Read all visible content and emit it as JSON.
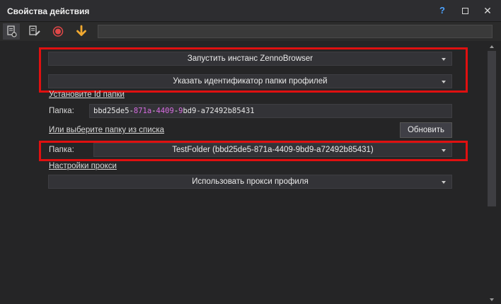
{
  "window": {
    "title": "Свойства действия",
    "help_label": "?",
    "close_label": "✕"
  },
  "toolbar": {
    "search_value": ""
  },
  "form": {
    "action_dropdown": "Запустить инстанс ZennoBrowser",
    "mode_dropdown": "Указать идентификатор папки профилей",
    "set_id_link": "Установите Id папки",
    "folder_label": "Папка:",
    "folder_id_parts": [
      "bbd25de5-",
      "871a",
      "-",
      "4409",
      "-",
      "9",
      "bd9-a72492b85431"
    ],
    "choose_link": "Или выберите папку из списка",
    "refresh_button": "Обновить",
    "folder_list_label": "Папка:",
    "folder_list_value": "TestFolder (bbd25de5-871a-4409-9bd9-a72492b85431)",
    "proxy_link": "Настройки прокси",
    "proxy_dropdown": "Использовать прокси профиля"
  },
  "colors": {
    "highlight_red": "#e01010",
    "id_accent": "#d66be0",
    "help_blue": "#4da3ff"
  }
}
